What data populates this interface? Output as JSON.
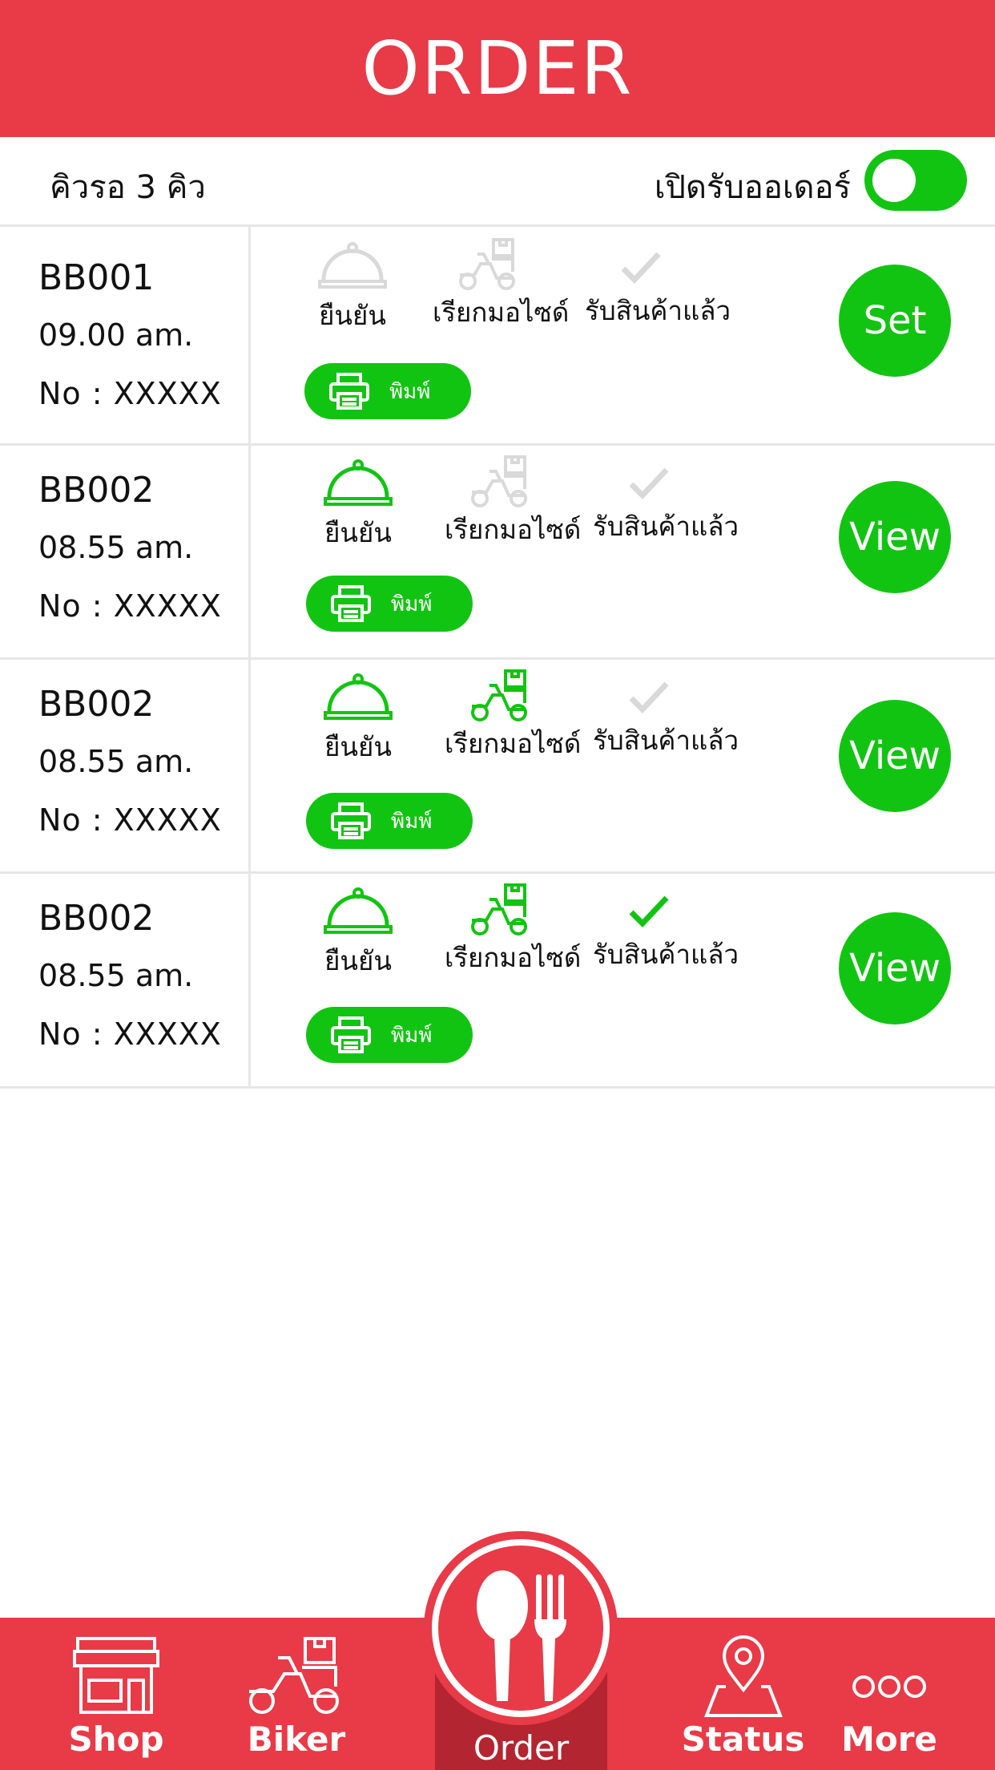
{
  "header": {
    "title": "ORDER"
  },
  "queue": {
    "label": "คิวรอ  3  คิว",
    "accept_label": "เปิดรับออเดอร์",
    "toggle_on": true
  },
  "steps": {
    "confirm": "ยืนยัน",
    "call_biker": "เรียกมอไซด์",
    "received": "รับสินค้าแล้ว"
  },
  "print_label": "พิมพ์",
  "orders": [
    {
      "code": "BB001",
      "time": "09.00  am.",
      "no": "No  :  XXXXX",
      "action": "Set",
      "confirm_done": false,
      "biker_done": false,
      "received_done": false
    },
    {
      "code": "BB002",
      "time": "08.55  am.",
      "no": "No  :  XXXXX",
      "action": "View",
      "confirm_done": true,
      "biker_done": false,
      "received_done": false
    },
    {
      "code": "BB002",
      "time": "08.55  am.",
      "no": "No  :  XXXXX",
      "action": "View",
      "confirm_done": true,
      "biker_done": true,
      "received_done": false
    },
    {
      "code": "BB002",
      "time": "08.55  am.",
      "no": "No  :  XXXXX",
      "action": "View",
      "confirm_done": true,
      "biker_done": true,
      "received_done": true
    }
  ],
  "tabs": {
    "shop": "Shop",
    "biker": "Biker",
    "order": "Order",
    "status": "Status",
    "more": "More"
  },
  "colors": {
    "brand_red": "#e93a47",
    "active_green": "#12c412",
    "inactive_gray": "#d9d9d9",
    "active_tab_bg": "#b32530"
  },
  "icons": [
    "cloche-icon",
    "motorbike-delivery-icon",
    "check-icon",
    "printer-icon",
    "shop-icon",
    "spoon-fork-icon",
    "map-pin-icon",
    "more-dots-icon"
  ]
}
